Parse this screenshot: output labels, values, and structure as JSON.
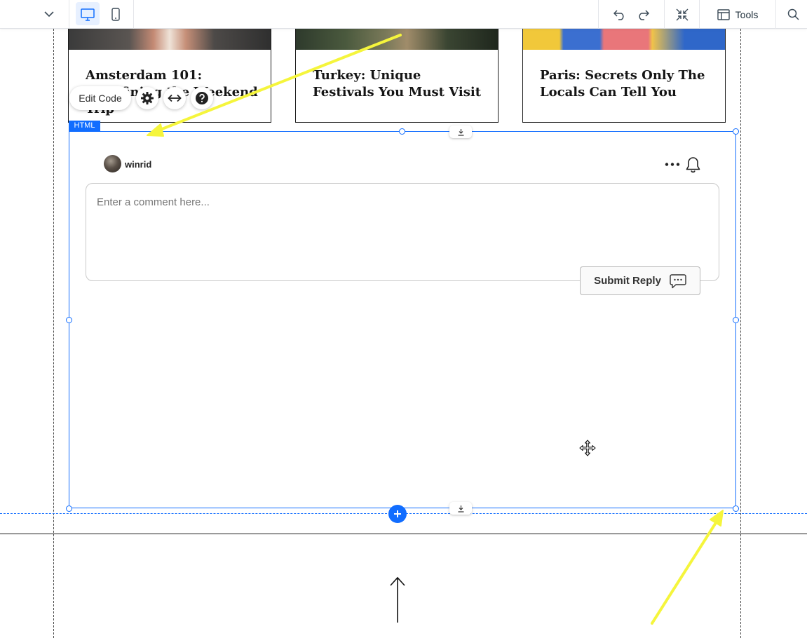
{
  "toolbar": {
    "dropdown_icon": "chevron-down-icon",
    "desktop_icon": "desktop-icon",
    "mobile_icon": "mobile-icon",
    "undo_icon": "undo-icon",
    "redo_icon": "redo-icon",
    "zoom_out_icon": "collapse-icon",
    "tools_label": "Tools",
    "tools_icon": "layout-panel-icon",
    "search_icon": "search-icon"
  },
  "blog_cards": [
    {
      "title": "Amsterdam 101: Redefining the Weekend Trip"
    },
    {
      "title": "Turkey: Unique Festivals You Must Visit"
    },
    {
      "title": "Paris: Secrets Only The Locals Can Tell You"
    }
  ],
  "element_toolbar": {
    "edit_code_label": "Edit Code",
    "settings_icon": "gear-icon",
    "stretch_icon": "stretch-arrows-icon",
    "help_icon": "help-icon"
  },
  "selected_element": {
    "tag": "HTML"
  },
  "comment_widget": {
    "username": "winrid",
    "placeholder": "Enter a comment here...",
    "submit_label": "Submit Reply",
    "more_icon": "more-dots-icon",
    "bell_icon": "bell-icon",
    "submit_icon": "chat-bubble-icon"
  },
  "colors": {
    "selection_blue": "#116dff",
    "annotation_yellow": "#f5f53c"
  }
}
